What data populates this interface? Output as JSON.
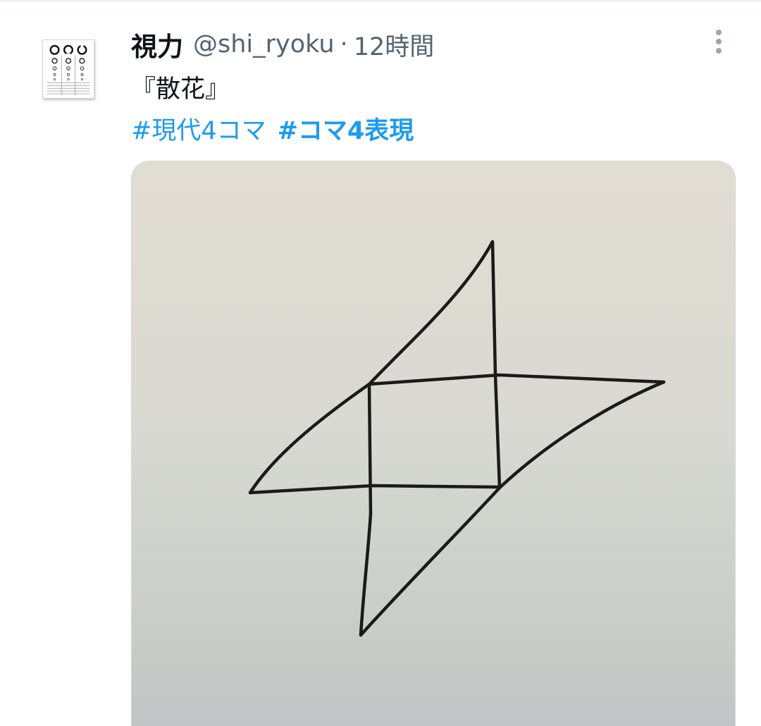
{
  "tweet": {
    "author_name": "視力",
    "handle": "@shi_ryoku",
    "separator": "·",
    "time": "12時間",
    "text": "『散花』",
    "hashtags": [
      {
        "label": "#現代4コマ",
        "bold": false
      },
      {
        "label": "#コマ4表現",
        "bold": true
      }
    ]
  },
  "icons": {
    "more": "more-vertical-icon",
    "avatar": "eye-chart-avatar"
  },
  "colors": {
    "text": "#0f1419",
    "secondary": "#536471",
    "link": "#1d9bf0"
  }
}
